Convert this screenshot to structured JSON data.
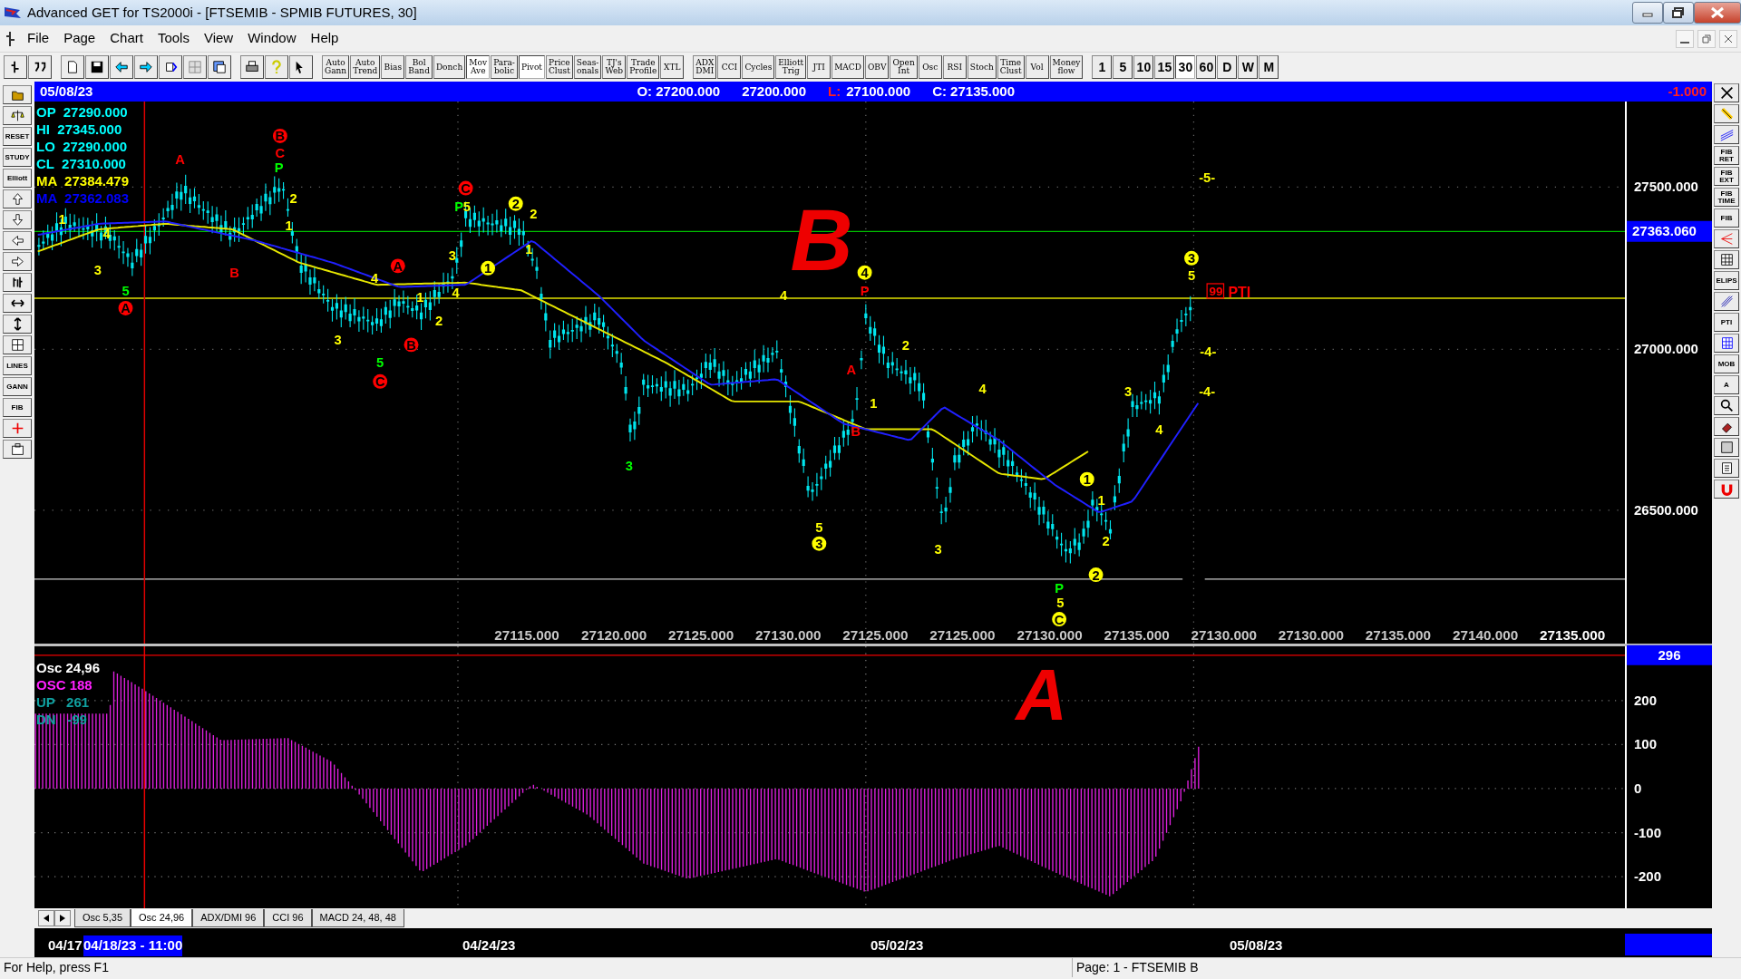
{
  "window": {
    "title": "Advanced GET for TS2000i - [FTSEMIB - SPMIB FUTURES, 30]"
  },
  "menu": [
    "File",
    "Page",
    "Chart",
    "Tools",
    "View",
    "Window",
    "Help"
  ],
  "study_buttons": [
    {
      "label": "Auto\nGann",
      "pressed": false
    },
    {
      "label": "Auto\nTrend",
      "pressed": false
    },
    {
      "label": "Bias",
      "pressed": false
    },
    {
      "label": "Bol\nBand",
      "pressed": false
    },
    {
      "label": "Donch",
      "pressed": false
    },
    {
      "label": "Mov\nAve",
      "pressed": true
    },
    {
      "label": "Para-\nbolic",
      "pressed": false
    },
    {
      "label": "Pivot",
      "pressed": true
    },
    {
      "label": "Price\nClust",
      "pressed": false
    },
    {
      "label": "Seas-\nonals",
      "pressed": false
    },
    {
      "label": "TJ's\nWeb",
      "pressed": false
    },
    {
      "label": "Trade\nProfile",
      "pressed": false
    },
    {
      "label": "XTL",
      "pressed": false
    }
  ],
  "indicator_buttons": [
    "ADX\nDMI",
    "CCI",
    "Cycles",
    "Elliott\nTrig",
    "JTI",
    "MACD",
    "OBV",
    "Open\nInt",
    "Osc",
    "RSI",
    "Stoch",
    "Time\nClust",
    "Vol",
    "Money\nflow"
  ],
  "intervals": [
    {
      "label": "1",
      "selected": false
    },
    {
      "label": "5",
      "selected": false
    },
    {
      "label": "10",
      "selected": false
    },
    {
      "label": "15",
      "selected": false
    },
    {
      "label": "30",
      "selected": true
    },
    {
      "label": "60",
      "selected": false
    },
    {
      "label": "D",
      "selected": false
    },
    {
      "label": "W",
      "selected": false
    },
    {
      "label": "M",
      "selected": false
    }
  ],
  "left_tools": [
    "RESET",
    "STUDY",
    "Elliott",
    "LINES",
    "GANN",
    "FIB"
  ],
  "right_tools": [
    "FIB\nRET",
    "FIB\nEXT",
    "FIB\nTIME",
    "FIB",
    "ELIPS",
    "PTI",
    "MOB",
    "A"
  ],
  "info_bar": {
    "date": "05/08/23",
    "open": "O: 27200.000",
    "high": "27200.000",
    "low_label": "L:",
    "low": "27100.000",
    "close": "C: 27135.000",
    "change": "-1.000"
  },
  "readouts": [
    {
      "label": "OP",
      "value": "27290.000",
      "color": "#00ffff"
    },
    {
      "label": "HI",
      "value": "27345.000",
      "color": "#00ffff"
    },
    {
      "label": "LO",
      "value": "27290.000",
      "color": "#00ffff"
    },
    {
      "label": "CL",
      "value": "27310.000",
      "color": "#00ffff"
    },
    {
      "label": "MA",
      "value": "27384.479",
      "color": "#ffff00"
    },
    {
      "label": "MA",
      "value": "27362.083",
      "color": "#0000ff"
    }
  ],
  "price_axis": {
    "ticks": [
      "27500.000",
      "27000.000",
      "26500.000"
    ],
    "current": "27363.060"
  },
  "wave_labels": [
    {
      "text": "A",
      "color": "#ff0000",
      "circled": false
    },
    {
      "text": "B",
      "color": "#ff0000",
      "circled": true
    },
    {
      "text": "C",
      "color": "#ff0000",
      "circled": false
    },
    {
      "text": "P",
      "color": "#00ff00",
      "circled": false
    },
    {
      "text": "2",
      "color": "#ffff00",
      "circled": false
    },
    {
      "text": "1",
      "color": "#ffff00",
      "circled": false
    },
    {
      "text": "1",
      "color": "#ffff00",
      "circled": false
    },
    {
      "text": "4",
      "color": "#ffff00",
      "circled": false
    },
    {
      "text": "3",
      "color": "#ffff00",
      "circled": false
    },
    {
      "text": "5",
      "color": "#00ff00",
      "circled": false
    },
    {
      "text": "A",
      "color": "#ff0000",
      "circled": true
    },
    {
      "text": "B",
      "color": "#ff0000",
      "circled": false
    },
    {
      "text": "A",
      "color": "#ff0000",
      "circled": true
    },
    {
      "text": "4",
      "color": "#ffff00",
      "circled": false
    },
    {
      "text": "1",
      "color": "#ffff00",
      "circled": false
    },
    {
      "text": "3",
      "color": "#ffff00",
      "circled": false
    },
    {
      "text": "4",
      "color": "#ffff00",
      "circled": false
    },
    {
      "text": "2",
      "color": "#ffff00",
      "circled": false
    },
    {
      "text": "3",
      "color": "#ffff00",
      "circled": false
    },
    {
      "text": "B",
      "color": "#ff0000",
      "circled": true
    },
    {
      "text": "5",
      "color": "#00ff00",
      "circled": false
    },
    {
      "text": "C",
      "color": "#ff0000",
      "circled": true
    },
    {
      "text": "C",
      "color": "#ff0000",
      "circled": true
    },
    {
      "text": "P",
      "color": "#00ff00",
      "circled": false
    },
    {
      "text": "5",
      "color": "#ffff00",
      "circled": false
    },
    {
      "text": "1",
      "color": "#ffff00",
      "circled": true
    },
    {
      "text": "2",
      "color": "#ffff00",
      "circled": true
    },
    {
      "text": "2",
      "color": "#ffff00",
      "circled": false
    },
    {
      "text": "1",
      "color": "#ffff00",
      "circled": false
    },
    {
      "text": "4",
      "color": "#ffff00",
      "circled": false
    },
    {
      "text": "4",
      "color": "#ffff00",
      "circled": true
    },
    {
      "text": "P",
      "color": "#ff0000",
      "circled": false
    },
    {
      "text": "2",
      "color": "#ffff00",
      "circled": false
    },
    {
      "text": "A",
      "color": "#ff0000",
      "circled": false
    },
    {
      "text": "1",
      "color": "#ffff00",
      "circled": false
    },
    {
      "text": "B",
      "color": "#ff0000",
      "circled": false
    },
    {
      "text": "3",
      "color": "#00ff00",
      "circled": false
    },
    {
      "text": "5",
      "color": "#ffff00",
      "circled": false
    },
    {
      "text": "3",
      "color": "#ffff00",
      "circled": true
    },
    {
      "text": "4",
      "color": "#ffff00",
      "circled": false
    },
    {
      "text": "3",
      "color": "#ffff00",
      "circled": false
    },
    {
      "text": "1",
      "color": "#ffff00",
      "circled": true
    },
    {
      "text": "1",
      "color": "#ffff00",
      "circled": false
    },
    {
      "text": "2",
      "color": "#ffff00",
      "circled": false
    },
    {
      "text": "2",
      "color": "#ffff00",
      "circled": true
    },
    {
      "text": "P",
      "color": "#00ff00",
      "circled": false
    },
    {
      "text": "5",
      "color": "#ffff00",
      "circled": false
    },
    {
      "text": "C",
      "color": "#ffff00",
      "circled": true
    },
    {
      "text": "3",
      "color": "#ffff00",
      "circled": false
    },
    {
      "text": "4",
      "color": "#ffff00",
      "circled": false
    },
    {
      "text": "3",
      "color": "#ffff00",
      "circled": true
    },
    {
      "text": "5",
      "color": "#ffff00",
      "circled": false
    },
    {
      "text": "-5-",
      "color": "#ffff00",
      "circled": false
    },
    {
      "text": "-4-",
      "color": "#ffff00",
      "circled": false
    },
    {
      "text": "-4-",
      "color": "#ffff00",
      "circled": false
    }
  ],
  "pti_marker": {
    "count": "99",
    "label": "PTI"
  },
  "handwritten_notes": [
    "B",
    "A"
  ],
  "price_scale_row": [
    "27115.000",
    "27120.000",
    "27125.000",
    "27130.000",
    "27125.000",
    "27125.000",
    "27130.000",
    "27135.000",
    "27130.000",
    "27130.000",
    "27135.000",
    "27140.000",
    "27135.000"
  ],
  "oscillator": {
    "title": "Osc 24,96",
    "value": "OSC 188",
    "up": "UP   261",
    "down": "DN   -99",
    "current": "296",
    "ticks": [
      "200",
      "100",
      "0",
      "-100",
      "-200"
    ]
  },
  "osc_tabs": [
    {
      "label": "Osc 5,35",
      "selected": false
    },
    {
      "label": "Osc 24,96",
      "selected": true
    },
    {
      "label": "ADX/DMI 96",
      "selected": false
    },
    {
      "label": "CCI 96",
      "selected": false
    },
    {
      "label": "MACD 24, 48, 48",
      "selected": false
    }
  ],
  "date_axis": [
    {
      "text": "04/17",
      "selected": false
    },
    {
      "text": "04/18/23 - 11:00",
      "selected": true
    },
    {
      "text": "04/24/23",
      "selected": false
    },
    {
      "text": "05/02/23",
      "selected": false
    },
    {
      "text": "05/08/23",
      "selected": false
    }
  ],
  "status_bar": {
    "help": "For Help, press F1",
    "page": "Page: 1 - FTSEMIB B"
  }
}
